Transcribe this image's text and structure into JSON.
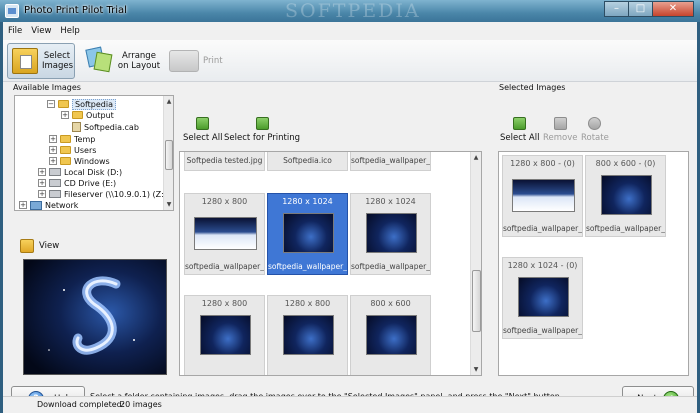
{
  "window": {
    "title": "Photo Print Pilot Trial",
    "watermark": "SOFTPEDIA"
  },
  "window_controls": {
    "minimize": "–",
    "maximize": "□",
    "close": "✕"
  },
  "menu": [
    "File",
    "View",
    "Help"
  ],
  "toolbar": {
    "select_images": "Select Images",
    "arrange_on_layout": "Arrange on Layout",
    "print": "Print"
  },
  "available_images": {
    "title": "Available Images",
    "tree": [
      {
        "label": "Softpedia",
        "type": "folder",
        "expander": "−",
        "selected": true
      },
      {
        "label": "Output",
        "type": "folder",
        "expander": "+"
      },
      {
        "label": "Softpedia.cab",
        "type": "file",
        "expander": ""
      },
      {
        "label": "Temp",
        "type": "folder",
        "expander": "+"
      },
      {
        "label": "Users",
        "type": "folder",
        "expander": "+"
      },
      {
        "label": "Windows",
        "type": "folder",
        "expander": "+"
      },
      {
        "label": "Local Disk (D:)",
        "type": "drive",
        "expander": "+"
      },
      {
        "label": "CD Drive (E:)",
        "type": "drive",
        "expander": "+"
      },
      {
        "label": "Fileserver (\\\\10.9.0.1) (Z:)",
        "type": "drive",
        "expander": "+"
      },
      {
        "label": "Network",
        "type": "network",
        "expander": "+"
      }
    ]
  },
  "view": {
    "label": "View"
  },
  "middle": {
    "select_all": "Select All",
    "select_for_printing": "Select for Printing",
    "top_row": [
      "Softpedia tested.jpg",
      "Softpedia.ico",
      "softpedia_wallpaper_..."
    ],
    "grid": [
      {
        "dim": "1280 x 800",
        "name": "softpedia_wallpaper_...",
        "selected": false
      },
      {
        "dim": "1280 x 1024",
        "name": "softpedia_wallpaper_...",
        "selected": true
      },
      {
        "dim": "1280 x 1024",
        "name": "softpedia_wallpaper_...",
        "selected": false
      },
      {
        "dim": "1280 x 800",
        "name": "",
        "selected": false
      },
      {
        "dim": "1280 x 800",
        "name": "",
        "selected": false
      },
      {
        "dim": "800 x 600",
        "name": "",
        "selected": false
      }
    ]
  },
  "selected_images": {
    "title": "Selected Images",
    "select_all": "Select All",
    "remove": "Remove",
    "rotate": "Rotate",
    "items": [
      {
        "dim": "1280 x 800 - (0)",
        "name": "softpedia_wallpaper_..."
      },
      {
        "dim": "800 x 600 - (0)",
        "name": "softpedia_wallpaper_..."
      },
      {
        "dim": "1280 x 1024 - (0)",
        "name": "softpedia_wallpaper_..."
      }
    ]
  },
  "bottom": {
    "help": "Help",
    "help_icon": "?",
    "instructions": "Select a folder containing images, drag the images over to the \"Selected Images\" panel, and press the \"Next\" button.",
    "next": "Next",
    "next_icon": "➜"
  },
  "status": {
    "download_label": "Download completed:",
    "count": "20 images"
  },
  "scroll": {
    "up": "▲",
    "down": "▼"
  }
}
